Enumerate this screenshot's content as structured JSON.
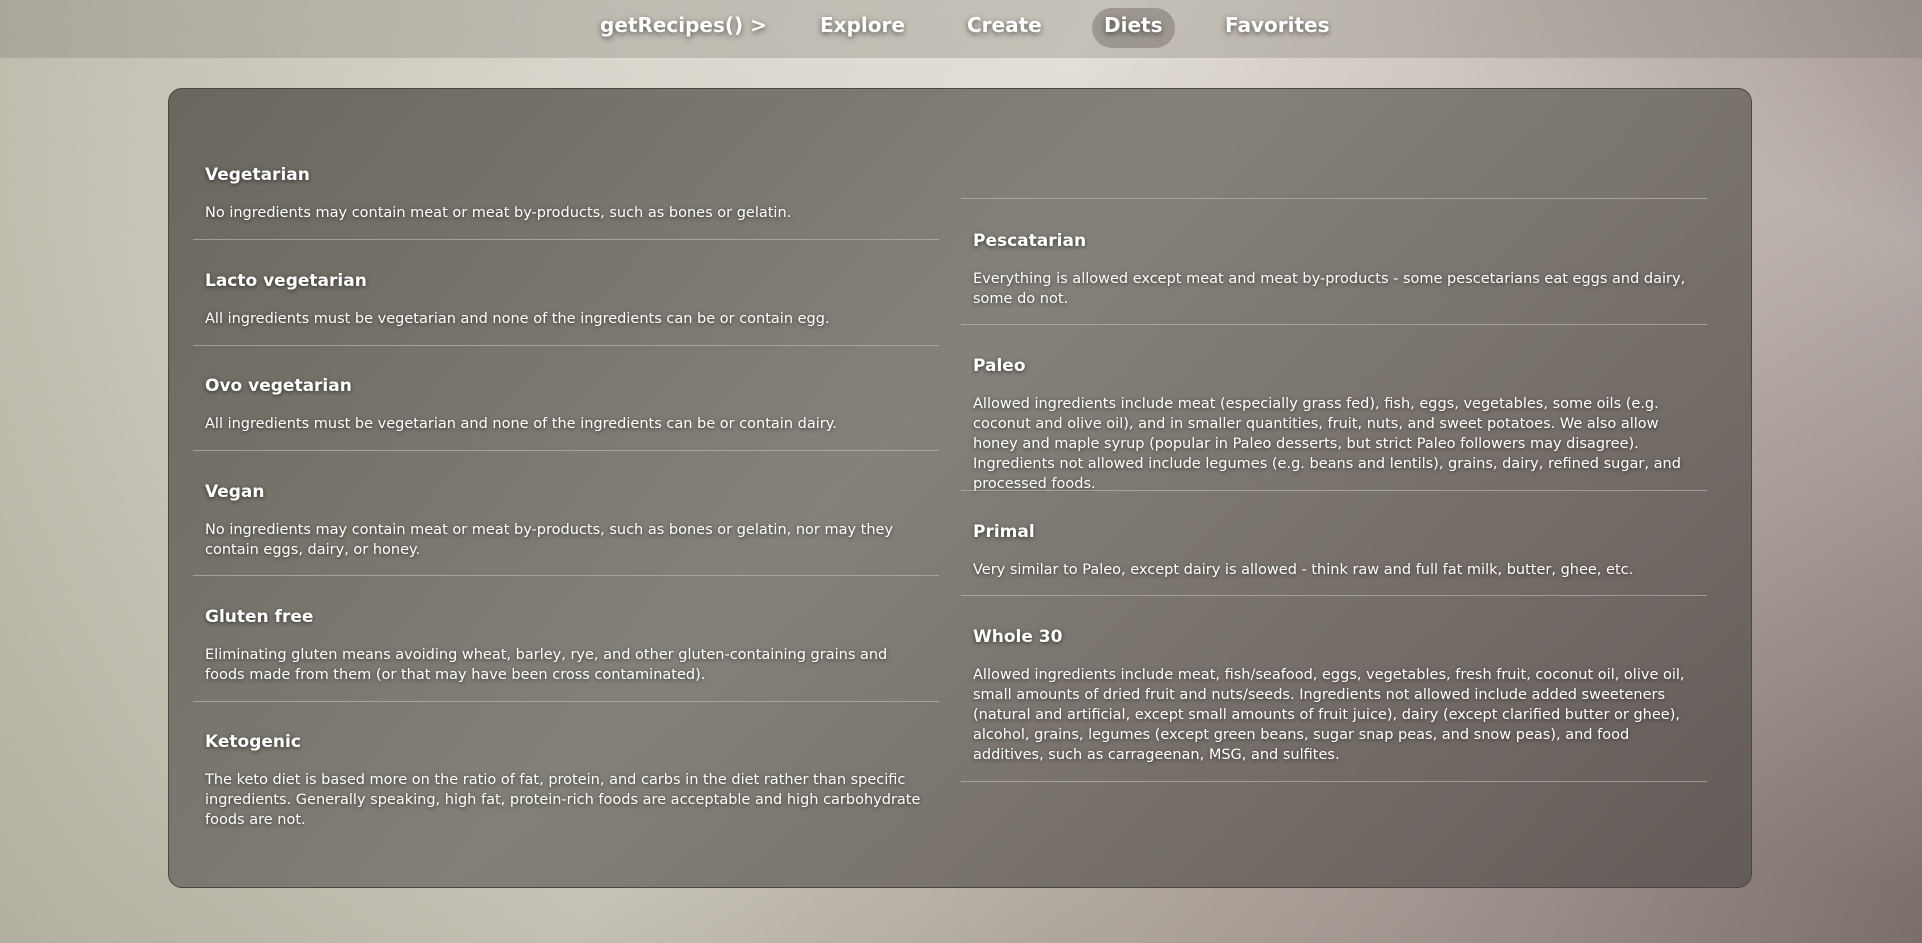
{
  "nav": {
    "brand": "getRecipes() >",
    "links": [
      "Explore",
      "Create",
      "Diets",
      "Favorites"
    ],
    "active": "Diets"
  },
  "diets": {
    "left": [
      {
        "name": "Vegetarian",
        "description": "No ingredients may contain meat or meat by-products, such as bones or gelatin."
      },
      {
        "name": "Lacto vegetarian",
        "description": "All ingredients must be vegetarian and none of the ingredients can be or contain egg."
      },
      {
        "name": "Ovo vegetarian",
        "description": "All ingredients must be vegetarian and none of the ingredients can be or contain dairy."
      },
      {
        "name": "Vegan",
        "description": "No ingredients may contain meat or meat by-products, such as bones or gelatin, nor may they contain eggs, dairy, or honey."
      },
      {
        "name": "Gluten free",
        "description": "Eliminating gluten means avoiding wheat, barley, rye, and other gluten-containing grains and foods made from them (or that may have been cross contaminated)."
      },
      {
        "name": "Ketogenic",
        "description": "The keto diet is based more on the ratio of fat, protein, and carbs in the diet rather than specific ingredients. Generally speaking, high fat, protein-rich foods are acceptable and high carbohydrate foods are not."
      }
    ],
    "right": [
      {
        "name": "Pescatarian",
        "description": "Everything is allowed except meat and meat by-products - some pescetarians eat eggs and dairy, some do not."
      },
      {
        "name": "Paleo",
        "description": "Allowed ingredients include meat (especially grass fed), fish, eggs, vegetables, some oils (e.g. coconut and olive oil), and in smaller quantities, fruit, nuts, and sweet potatoes. We also allow honey and maple syrup (popular in Paleo desserts, but strict Paleo followers may disagree). Ingredients not allowed include legumes (e.g. beans and lentils), grains, dairy, refined sugar, and processed foods."
      },
      {
        "name": "Primal",
        "description": "Very similar to Paleo, except dairy is allowed - think raw and full fat milk, butter, ghee, etc."
      },
      {
        "name": "Whole 30",
        "description": "Allowed ingredients include meat, fish/seafood, eggs, vegetables, fresh fruit, coconut oil, olive oil, small amounts of dried fruit and nuts/seeds. Ingredients not allowed include added sweeteners (natural and artificial, except small amounts of fruit juice), dairy (except clarified butter or ghee), alcohol, grains, legumes (except green beans, sugar snap peas, and snow peas), and food additives, such as carrageenan, MSG, and sulfites."
      }
    ]
  }
}
